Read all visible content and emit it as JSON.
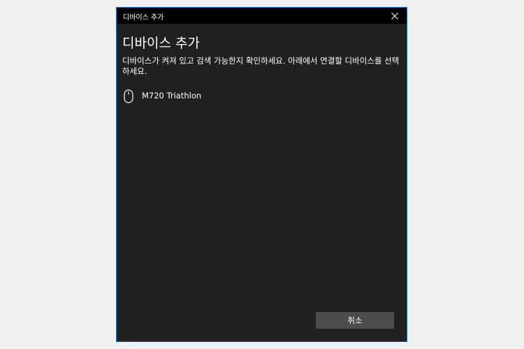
{
  "window": {
    "title": "디바이스 추가"
  },
  "dialog": {
    "heading": "디바이스 추가",
    "instruction": "디바이스가 켜져 있고 검색 가능한지 확인하세요. 아래에서 연결할 디바이스를 선택하세요."
  },
  "devices": [
    {
      "name": "M720 Triathlon",
      "icon": "mouse-icon"
    }
  ],
  "buttons": {
    "cancel_label": "취소"
  }
}
